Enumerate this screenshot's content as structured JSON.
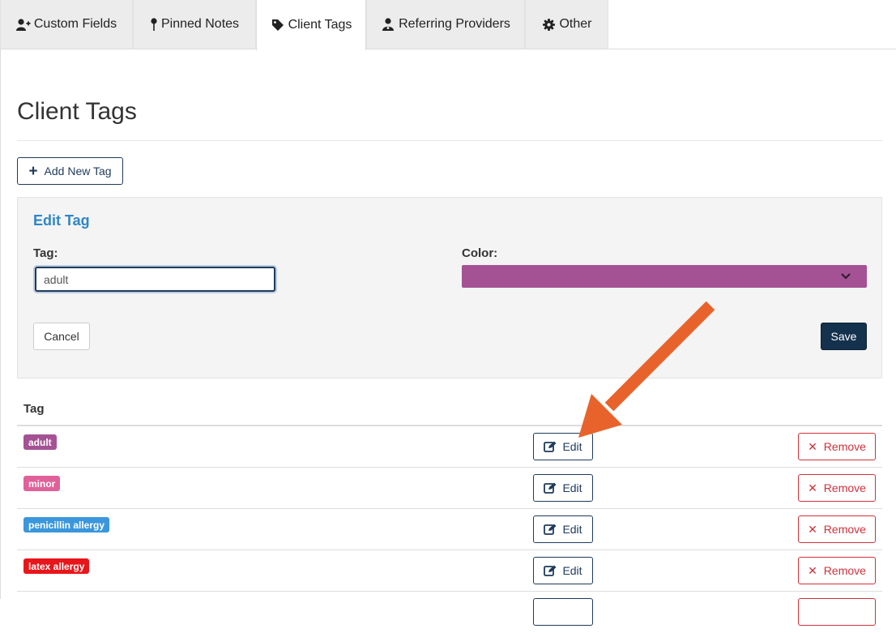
{
  "tabs": [
    {
      "label": "Custom Fields",
      "icon": "user-plus-icon"
    },
    {
      "label": "Pinned Notes",
      "icon": "pin-icon"
    },
    {
      "label": "Client Tags",
      "icon": "tag-icon",
      "active": true
    },
    {
      "label": "Referring Providers",
      "icon": "user-doctor-icon"
    },
    {
      "label": "Other",
      "icon": "gear-icon"
    }
  ],
  "page": {
    "title": "Client Tags"
  },
  "add_button": {
    "label": "Add New Tag"
  },
  "edit_panel": {
    "title": "Edit Tag",
    "tag_label": "Tag:",
    "tag_value": "adult",
    "color_label": "Color:",
    "color_value": "#a45294",
    "cancel_label": "Cancel",
    "save_label": "Save"
  },
  "table": {
    "header": "Tag",
    "edit_label": "Edit",
    "remove_label": "Remove",
    "rows": [
      {
        "tag": "adult",
        "color": "#a45294"
      },
      {
        "tag": "minor",
        "color": "#e0619a"
      },
      {
        "tag": "penicillin allergy",
        "color": "#3a97dc"
      },
      {
        "tag": "latex allergy",
        "color": "#e8161b"
      }
    ]
  },
  "annotation": {
    "color": "#e8632b"
  }
}
